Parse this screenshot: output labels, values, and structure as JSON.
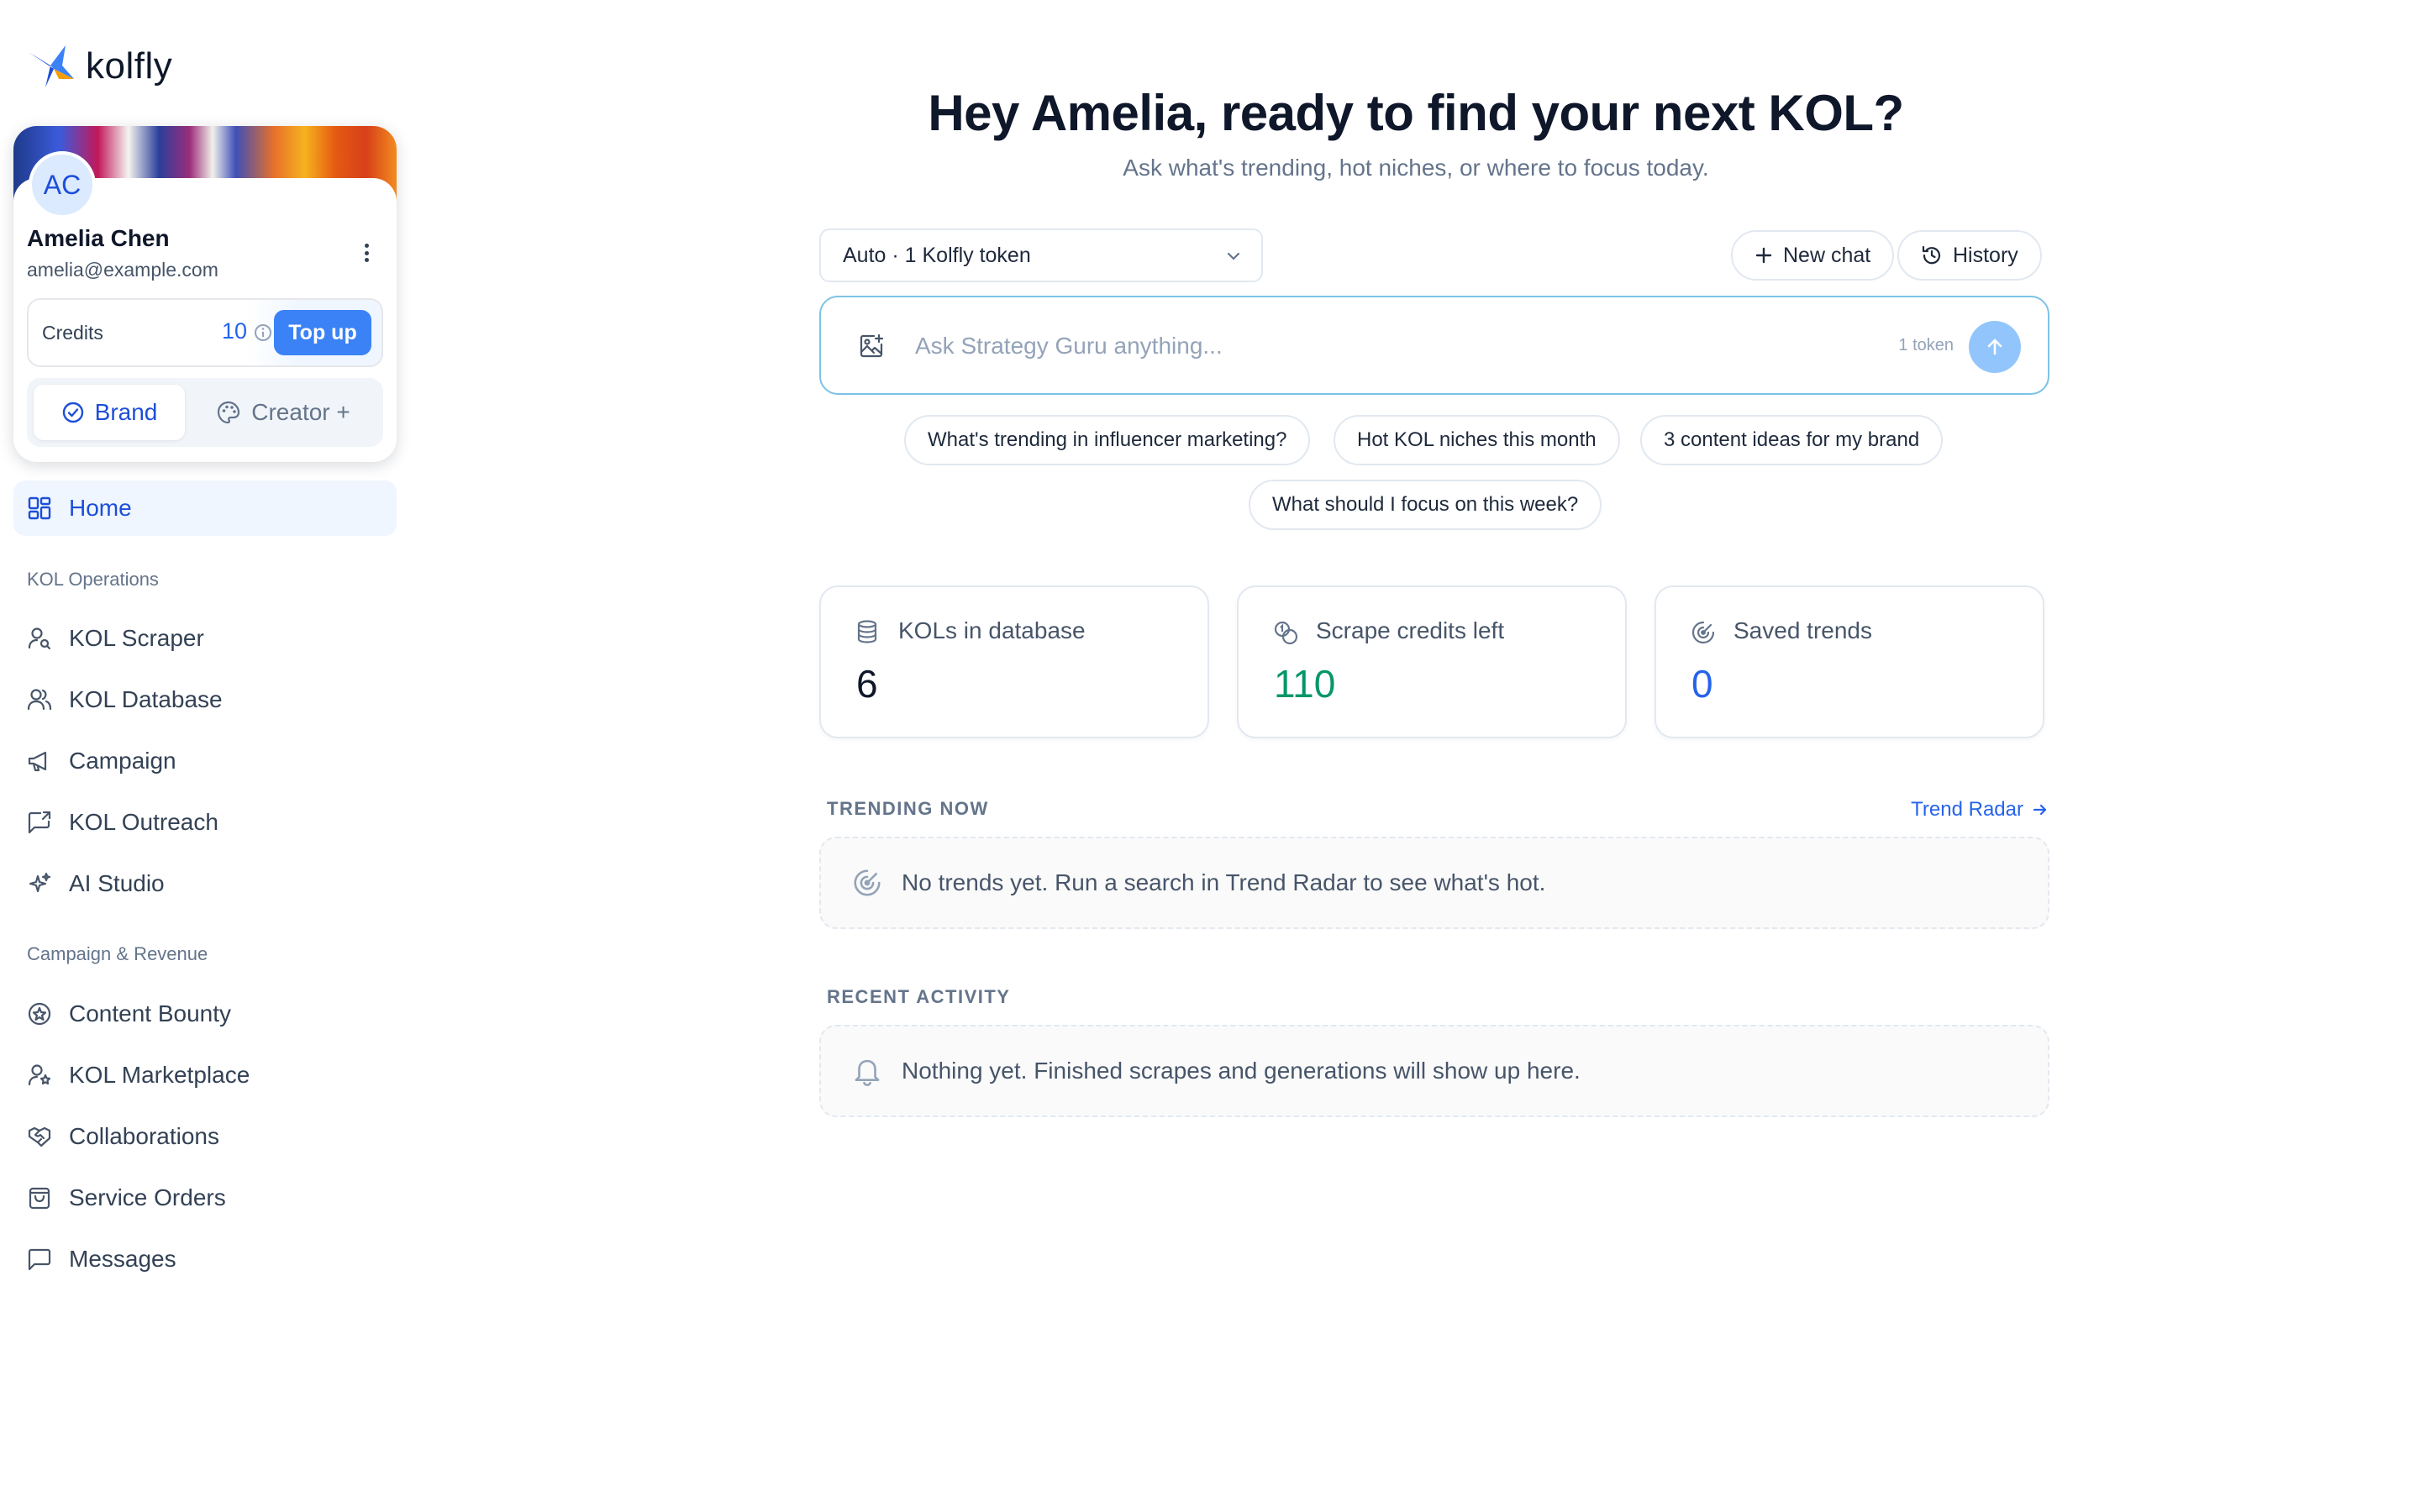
{
  "app": {
    "name": "kolfly"
  },
  "profile": {
    "initials": "AC",
    "name": "Amelia Chen",
    "email": "amelia@example.com",
    "credits_label": "Credits",
    "credits_value": "10",
    "topup_label": "Top up",
    "modes": {
      "brand": "Brand",
      "creator": "Creator +"
    }
  },
  "nav": {
    "home": "Home",
    "sections": [
      {
        "label": "KOL Operations",
        "items": [
          "KOL Scraper",
          "KOL Database",
          "Campaign",
          "KOL Outreach",
          "AI Studio"
        ]
      },
      {
        "label": "Campaign & Revenue",
        "items": [
          "Content Bounty",
          "KOL Marketplace",
          "Collaborations",
          "Service Orders",
          "Messages"
        ]
      }
    ]
  },
  "hero": {
    "title": "Hey Amelia, ready to find your next KOL?",
    "subtitle": "Ask what's trending, hot niches, or where to focus today."
  },
  "chat": {
    "model_label": "Auto · 1 Kolfly token",
    "new_chat_label": "New chat",
    "history_label": "History",
    "placeholder": "Ask Strategy Guru anything...",
    "token_hint": "1 token"
  },
  "suggestions": [
    "What's trending in influencer marketing?",
    "Hot KOL niches this month",
    "3 content ideas for my brand",
    "What should I focus on this week?"
  ],
  "stats": [
    {
      "label": "KOLs in database",
      "value": "6",
      "color": "#0f172a",
      "icon": "database-icon"
    },
    {
      "label": "Scrape credits left",
      "value": "110",
      "color": "#059669",
      "icon": "coins-icon"
    },
    {
      "label": "Saved trends",
      "value": "0",
      "color": "#2563eb",
      "icon": "radar-icon"
    }
  ],
  "trending": {
    "heading": "TRENDING NOW",
    "link": "Trend Radar",
    "empty": "No trends yet. Run a search in Trend Radar to see what's hot."
  },
  "activity": {
    "heading": "RECENT ACTIVITY",
    "empty": "Nothing yet. Finished scrapes and generations will show up here."
  },
  "colors": {
    "accent": "#3b82f6",
    "link": "#2563eb",
    "active_nav_bg": "#eff6ff"
  }
}
